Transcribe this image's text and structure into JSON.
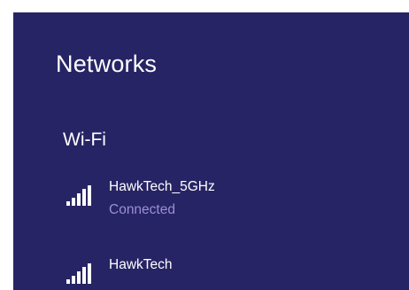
{
  "panel": {
    "title": "Networks",
    "background": "#272465"
  },
  "wifi": {
    "section_label": "Wi-Fi",
    "networks": [
      {
        "name": "HawkTech_5GHz",
        "status": "Connected",
        "signal_icon": "wifi-signal-full-icon"
      },
      {
        "name": "HawkTech",
        "status": "",
        "signal_icon": "wifi-signal-full-icon"
      }
    ]
  },
  "colors": {
    "accent_status": "#9b8ed6",
    "text": "#ffffff"
  }
}
